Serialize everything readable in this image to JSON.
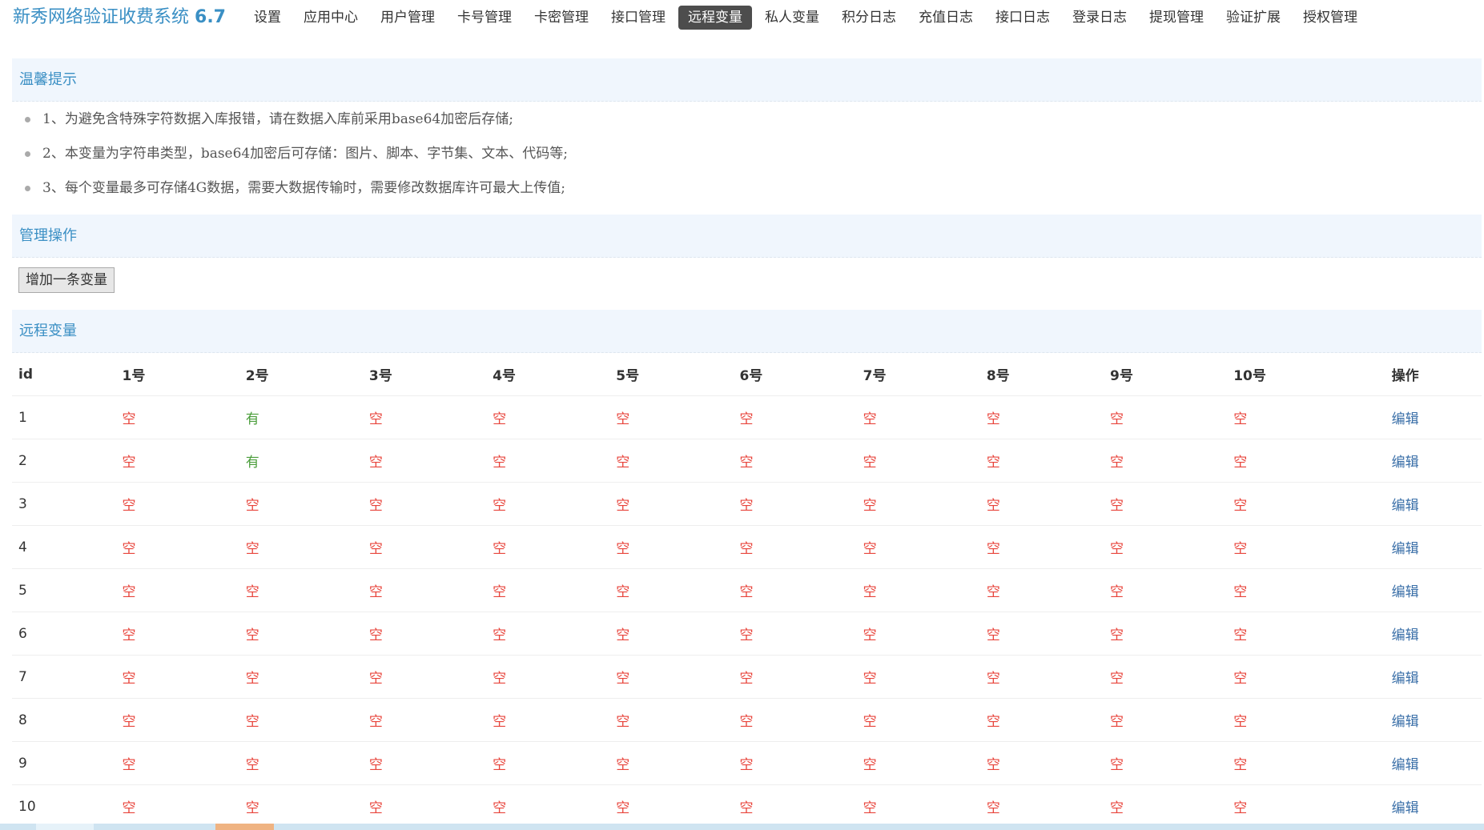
{
  "header": {
    "brand": "新秀网络验证收费系统",
    "version": "6.7",
    "nav": [
      {
        "label": "设置",
        "name": "nav-settings",
        "active": false
      },
      {
        "label": "应用中心",
        "name": "nav-app-center",
        "active": false
      },
      {
        "label": "用户管理",
        "name": "nav-user-management",
        "active": false
      },
      {
        "label": "卡号管理",
        "name": "nav-card-number-management",
        "active": false
      },
      {
        "label": "卡密管理",
        "name": "nav-card-key-management",
        "active": false
      },
      {
        "label": "接口管理",
        "name": "nav-api-management",
        "active": false
      },
      {
        "label": "远程变量",
        "name": "nav-remote-variables",
        "active": true
      },
      {
        "label": "私人变量",
        "name": "nav-private-variables",
        "active": false
      },
      {
        "label": "积分日志",
        "name": "nav-points-log",
        "active": false
      },
      {
        "label": "充值日志",
        "name": "nav-recharge-log",
        "active": false
      },
      {
        "label": "接口日志",
        "name": "nav-api-log",
        "active": false
      },
      {
        "label": "登录日志",
        "name": "nav-login-log",
        "active": false
      },
      {
        "label": "提现管理",
        "name": "nav-withdraw-management",
        "active": false
      },
      {
        "label": "验证扩展",
        "name": "nav-verify-extension",
        "active": false
      },
      {
        "label": "授权管理",
        "name": "nav-license-management",
        "active": false
      }
    ]
  },
  "tips": {
    "title": "温馨提示",
    "items": [
      "1、为避免含特殊字符数据入库报错，请在数据入库前采用base64加密后存储;",
      "2、本变量为字符串类型，base64加密后可存储：图片、脚本、字节集、文本、代码等;",
      "3、每个变量最多可存储4G数据，需要大数据传输时，需要修改数据库许可最大上传值;"
    ]
  },
  "ops": {
    "title": "管理操作",
    "add_button": "增加一条变量"
  },
  "vars": {
    "title": "远程变量",
    "columns": [
      "id",
      "1号",
      "2号",
      "3号",
      "4号",
      "5号",
      "6号",
      "7号",
      "8号",
      "9号",
      "10号",
      "操作"
    ],
    "edit_label": "编辑",
    "rows": [
      {
        "id": "1",
        "cells": [
          "空",
          "有",
          "空",
          "空",
          "空",
          "空",
          "空",
          "空",
          "空",
          "空"
        ]
      },
      {
        "id": "2",
        "cells": [
          "空",
          "有",
          "空",
          "空",
          "空",
          "空",
          "空",
          "空",
          "空",
          "空"
        ]
      },
      {
        "id": "3",
        "cells": [
          "空",
          "空",
          "空",
          "空",
          "空",
          "空",
          "空",
          "空",
          "空",
          "空"
        ]
      },
      {
        "id": "4",
        "cells": [
          "空",
          "空",
          "空",
          "空",
          "空",
          "空",
          "空",
          "空",
          "空",
          "空"
        ]
      },
      {
        "id": "5",
        "cells": [
          "空",
          "空",
          "空",
          "空",
          "空",
          "空",
          "空",
          "空",
          "空",
          "空"
        ]
      },
      {
        "id": "6",
        "cells": [
          "空",
          "空",
          "空",
          "空",
          "空",
          "空",
          "空",
          "空",
          "空",
          "空"
        ]
      },
      {
        "id": "7",
        "cells": [
          "空",
          "空",
          "空",
          "空",
          "空",
          "空",
          "空",
          "空",
          "空",
          "空"
        ]
      },
      {
        "id": "8",
        "cells": [
          "空",
          "空",
          "空",
          "空",
          "空",
          "空",
          "空",
          "空",
          "空",
          "空"
        ]
      },
      {
        "id": "9",
        "cells": [
          "空",
          "空",
          "空",
          "空",
          "空",
          "空",
          "空",
          "空",
          "空",
          "空"
        ]
      },
      {
        "id": "10",
        "cells": [
          "空",
          "空",
          "空",
          "空",
          "空",
          "空",
          "空",
          "空",
          "空",
          "空"
        ]
      }
    ]
  },
  "colors": {
    "brand": "#3a8fc4",
    "empty": "#e8453c",
    "has": "#4a9d3a",
    "link": "#3a6fa8",
    "active_nav": "#4d4d4d"
  }
}
